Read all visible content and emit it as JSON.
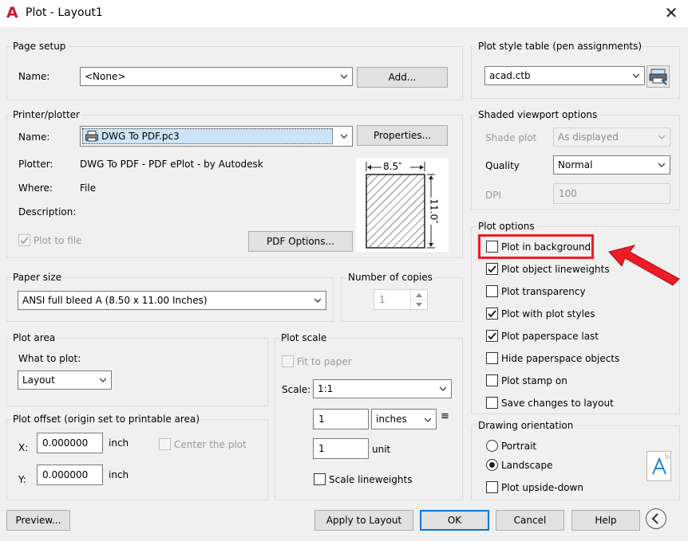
{
  "window": {
    "title": "Plot - Layout1"
  },
  "page_setup": {
    "label": "Page setup",
    "name_label": "Name:",
    "name_value": "<None>",
    "add_button": "Add..."
  },
  "printer": {
    "label": "Printer/plotter",
    "name_label": "Name:",
    "name_value": "DWG To PDF.pc3",
    "properties_button": "Properties...",
    "plotter_label": "Plotter:",
    "plotter_value": "DWG To PDF - PDF ePlot - by Autodesk",
    "where_label": "Where:",
    "where_value": "File",
    "description_label": "Description:",
    "plot_to_file_label": "Plot to file",
    "pdf_options_button": "PDF Options...",
    "preview_width": "8.5″",
    "preview_height": "11.0″"
  },
  "paper_size": {
    "label": "Paper size",
    "value": "ANSI full bleed A (8.50 x 11.00 Inches)"
  },
  "copies": {
    "label": "Number of copies",
    "value": "1"
  },
  "plot_area": {
    "label": "Plot area",
    "what_label": "What to plot:",
    "what_value": "Layout"
  },
  "plot_offset": {
    "label": "Plot offset (origin set to printable area)",
    "x_label": "X:",
    "x_value": "0.000000",
    "x_unit": "inch",
    "y_label": "Y:",
    "y_value": "0.000000",
    "y_unit": "inch",
    "center_label": "Center the plot"
  },
  "plot_scale": {
    "label": "Plot scale",
    "fit_label": "Fit to paper",
    "scale_label": "Scale:",
    "scale_value": "1:1",
    "value1": "1",
    "units_value": "inches",
    "equals": "≡",
    "value2": "1",
    "unit_label": "unit",
    "lineweights_label": "Scale lineweights"
  },
  "plot_style": {
    "label": "Plot style table (pen assignments)",
    "value": "acad.ctb"
  },
  "shaded": {
    "label": "Shaded viewport options",
    "shade_label": "Shade plot",
    "shade_value": "As displayed",
    "quality_label": "Quality",
    "quality_value": "Normal",
    "dpi_label": "DPI",
    "dpi_value": "100"
  },
  "plot_options": {
    "label": "Plot options",
    "items": [
      {
        "label": "Plot in background",
        "checked": false
      },
      {
        "label": "Plot object lineweights",
        "checked": true
      },
      {
        "label": "Plot transparency",
        "checked": false
      },
      {
        "label": "Plot with plot styles",
        "checked": true
      },
      {
        "label": "Plot paperspace last",
        "checked": true
      },
      {
        "label": "Hide paperspace objects",
        "checked": false
      },
      {
        "label": "Plot stamp on",
        "checked": false
      },
      {
        "label": "Save changes to layout",
        "checked": false
      }
    ]
  },
  "orientation": {
    "label": "Drawing orientation",
    "portrait": "Portrait",
    "landscape": "Landscape",
    "selected": "landscape",
    "upside_down": "Plot upside-down"
  },
  "footer": {
    "preview": "Preview...",
    "apply": "Apply to Layout",
    "ok": "OK",
    "cancel": "Cancel",
    "help": "Help"
  },
  "colors": {
    "annotation_red": "#ee1c25",
    "accent_blue": "#0078d7"
  }
}
